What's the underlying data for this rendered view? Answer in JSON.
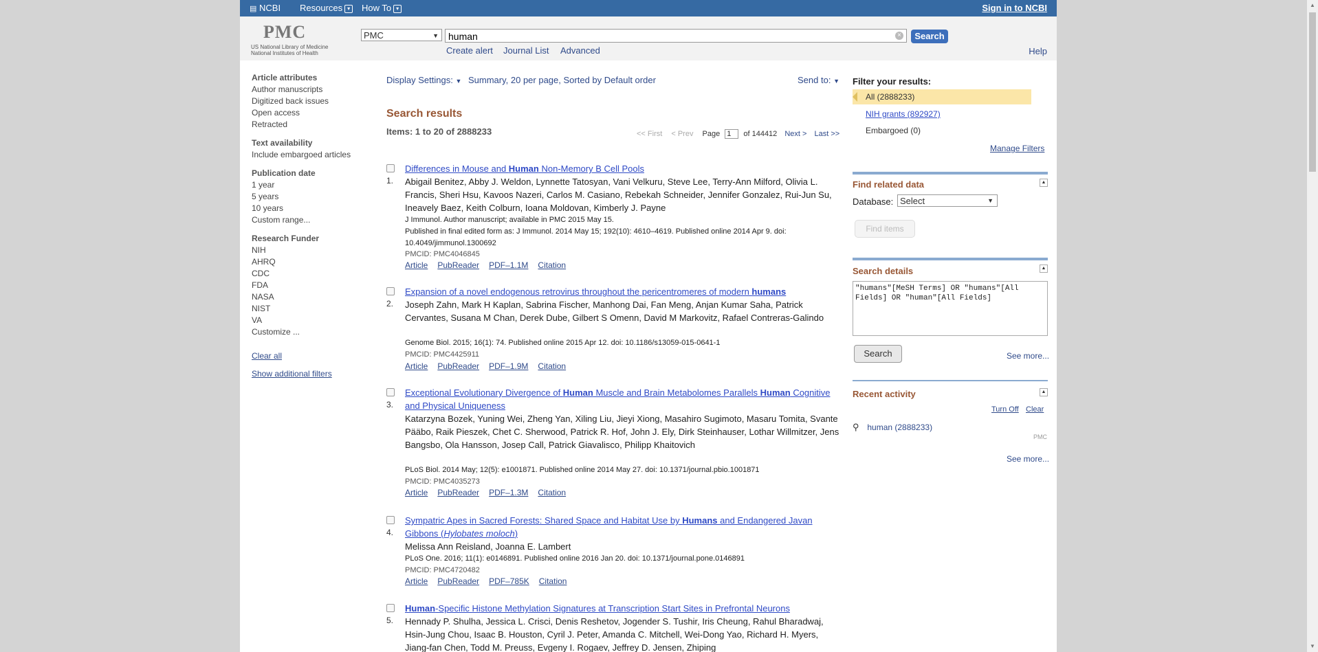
{
  "topbar": {
    "ncbi": "NCBI",
    "resources": "Resources",
    "howto": "How To",
    "signin": "Sign in to NCBI"
  },
  "header": {
    "logo": "PMC",
    "logo_line1": "US National Library of Medicine",
    "logo_line2": "National Institutes of Health",
    "database": "PMC",
    "query": "human",
    "search_label": "Search",
    "links": [
      "Create alert",
      "Journal List",
      "Advanced"
    ],
    "help": "Help"
  },
  "sidebar": {
    "article_attributes": {
      "title": "Article attributes",
      "items": [
        "Author manuscripts",
        "Digitized back issues",
        "Open access",
        "Retracted"
      ]
    },
    "text_availability": {
      "title": "Text availability",
      "items": [
        "Include embargoed articles"
      ]
    },
    "publication_date": {
      "title": "Publication date",
      "items": [
        "1 year",
        "5 years",
        "10 years",
        "Custom range..."
      ]
    },
    "research_funder": {
      "title": "Research Funder",
      "items": [
        "NIH",
        "AHRQ",
        "CDC",
        "FDA",
        "NASA",
        "NIST",
        "VA",
        "Customize ..."
      ]
    },
    "clear_all": "Clear all",
    "show_filters": "Show additional filters"
  },
  "toolbar": {
    "display_settings": "Display Settings:",
    "display_value": "Summary, 20 per page, Sorted by Default order",
    "send_to": "Send to:"
  },
  "results": {
    "title": "Search results",
    "count": "Items: 1 to 20 of 2888233",
    "pager": {
      "first": "<< First",
      "prev": "< Prev",
      "page_label": "Page",
      "page": "1",
      "of": "of 144412",
      "next": "Next >",
      "last": "Last >>"
    },
    "items": [
      {
        "num": "1.",
        "title_parts": [
          "Differences in Mouse and ",
          "Human",
          " Non-Memory B Cell Pools"
        ],
        "authors": "Abigail Benitez, Abby J. Weldon, Lynnette Tatosyan, Vani Velkuru, Steve Lee, Terry-Ann Milford, Olivia L. Francis, Sheri Hsu, Kavoos Nazeri, Carlos M. Casiano, Rebekah Schneider, Jennifer Gonzalez, Rui-Jun Su, Ineavely Baez, Keith Colburn, Ioana Moldovan, Kimberly J. Payne",
        "journal": "J Immunol. Author manuscript; available in PMC 2015 May 15.",
        "journal2": "Published in final edited form as: J Immunol. 2014 May 15; 192(10): 4610–4619. Published online 2014 Apr 9. doi: 10.4049/jimmunol.1300692",
        "pmcid": "PMCID: PMC4046845",
        "links": [
          "Article",
          "PubReader",
          "PDF–1.1M",
          "Citation"
        ]
      },
      {
        "num": "2.",
        "title_parts": [
          "Expansion of a novel endogenous retrovirus throughout the pericentromeres of modern ",
          "humans",
          ""
        ],
        "authors": "Joseph Zahn, Mark H Kaplan, Sabrina Fischer, Manhong Dai, Fan Meng, Anjan Kumar Saha, Patrick Cervantes, Susana M Chan, Derek Dube, Gilbert S Omenn, David M Markovitz, Rafael Contreras-Galindo",
        "journal": "Genome Biol. 2015; 16(1): 74. Published online 2015 Apr 12. doi: 10.1186/s13059-015-0641-1",
        "journal2": "",
        "pmcid": "PMCID: PMC4425911",
        "links": [
          "Article",
          "PubReader",
          "PDF–1.9M",
          "Citation"
        ]
      },
      {
        "num": "3.",
        "title_parts": [
          "Exceptional Evolutionary Divergence of ",
          "Human",
          " Muscle and Brain Metabolomes Parallels ",
          "Human",
          " Cognitive and Physical Uniqueness"
        ],
        "authors": "Katarzyna Bozek, Yuning Wei, Zheng Yan, Xiling Liu, Jieyi Xiong, Masahiro Sugimoto, Masaru Tomita, Svante Pääbo, Raik Pieszek, Chet C. Sherwood, Patrick R. Hof, John J. Ely, Dirk Steinhauser, Lothar Willmitzer, Jens Bangsbo, Ola Hansson, Josep Call, Patrick Giavalisco, Philipp Khaitovich",
        "journal": "PLoS Biol. 2014 May; 12(5): e1001871. Published online 2014 May 27. doi: 10.1371/journal.pbio.1001871",
        "journal2": "",
        "pmcid": "PMCID: PMC4035273",
        "links": [
          "Article",
          "PubReader",
          "PDF–1.3M",
          "Citation"
        ]
      },
      {
        "num": "4.",
        "title_parts": [
          "Sympatric Apes in Sacred Forests: Shared Space and Habitat Use by ",
          "Humans",
          " and Endangered Javan Gibbons (",
          "Hylobates moloch",
          ")"
        ],
        "authors": "Melissa Ann Reisland, Joanna E. Lambert",
        "journal": "PLoS One. 2016; 11(1): e0146891. Published online 2016 Jan 20. doi: 10.1371/journal.pone.0146891",
        "journal2": "",
        "pmcid": "PMCID: PMC4720482",
        "links": [
          "Article",
          "PubReader",
          "PDF–785K",
          "Citation"
        ]
      },
      {
        "num": "5.",
        "title_parts": [
          "Human",
          "-Specific Histone Methylation Signatures at Transcription Start Sites in Prefrontal Neurons"
        ],
        "authors": "Hennady P. Shulha, Jessica L. Crisci, Denis Reshetov, Jogender S. Tushir, Iris Cheung, Rahul Bharadwaj, Hsin-Jung Chou, Isaac B. Houston, Cyril J. Peter, Amanda C. Mitchell, Wei-Dong Yao, Richard H. Myers, Jiang-fan Chen, Todd M. Preuss, Evgeny I. Rogaev, Jeffrey D. Jensen, Zhiping",
        "journal": "",
        "journal2": "",
        "pmcid": "",
        "links": []
      }
    ]
  },
  "right": {
    "filter_title": "Filter your results:",
    "filters": [
      "All (2888233)",
      "NIH grants (892927)",
      "Embargoed (0)"
    ],
    "manage_filters": "Manage Filters",
    "find_related": "Find related data",
    "database_label": "Database:",
    "database_value": "Select",
    "find_items": "Find items",
    "search_details": "Search details",
    "details_query": "\"humans\"[MeSH Terms] OR \"humans\"[All Fields] OR \"human\"[All Fields]",
    "details_search": "Search",
    "see_more": "See more...",
    "recent_activity": "Recent activity",
    "turn_off": "Turn Off",
    "clear": "Clear",
    "activity_item": "human (2888233)",
    "activity_db": "PMC",
    "see_more2": "See more..."
  }
}
